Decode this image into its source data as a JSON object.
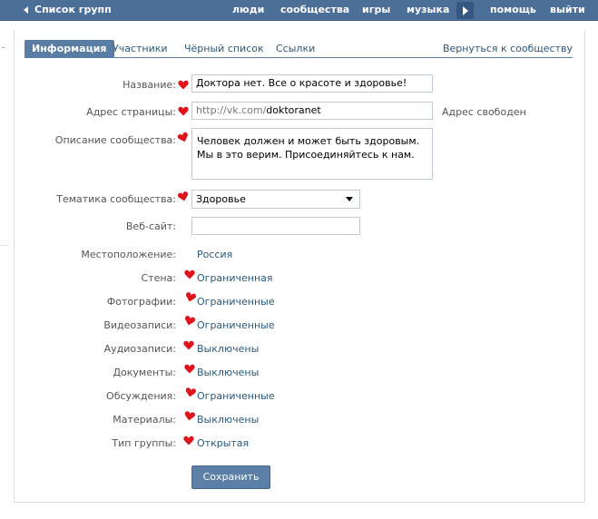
{
  "topbar": {
    "back_label": "Список групп",
    "links": [
      "люди",
      "сообщества",
      "игры",
      "музыка"
    ],
    "help": "помощь",
    "logout": "выйти"
  },
  "tabs": {
    "items": [
      "Информация",
      "Участники",
      "Чёрный список",
      "Ссылки"
    ],
    "back_to_community": "Вернуться к сообществу"
  },
  "form": {
    "name": {
      "label": "Название:",
      "value": "Доктора нет. Все о красоте и здоровье!"
    },
    "address": {
      "label": "Адрес страницы:",
      "prefix": "http://vk.com/",
      "value": "doktoranet",
      "status": "Адрес свободен"
    },
    "description": {
      "label": "Описание сообщества:",
      "value": "Человек должен и может быть здоровым. Мы в это верим. Присоединяйтесь к нам."
    },
    "topic": {
      "label": "Тематика сообщества:",
      "value": "Здоровье"
    },
    "website": {
      "label": "Веб-сайт:",
      "value": ""
    },
    "location": {
      "label": "Местоположение:",
      "value": "Россия"
    },
    "wall": {
      "label": "Стена:",
      "value": "Ограниченная"
    },
    "photos": {
      "label": "Фотографии:",
      "value": "Ограниченные"
    },
    "videos": {
      "label": "Видеозаписи:",
      "value": "Ограниченные"
    },
    "audio": {
      "label": "Аудиозаписи:",
      "value": "Выключены"
    },
    "documents": {
      "label": "Документы:",
      "value": "Выключены"
    },
    "discussions": {
      "label": "Обсуждения:",
      "value": "Ограниченные"
    },
    "materials": {
      "label": "Материалы:",
      "value": "Выключены"
    },
    "group_type": {
      "label": "Тип группы:",
      "value": "Открытая"
    },
    "save_label": "Сохранить"
  },
  "colors": {
    "topbar": "#4b6f97",
    "link": "#2b587a",
    "tab_active": "#597da3",
    "heart": "#e0121b",
    "button": "#5b7fa6"
  }
}
